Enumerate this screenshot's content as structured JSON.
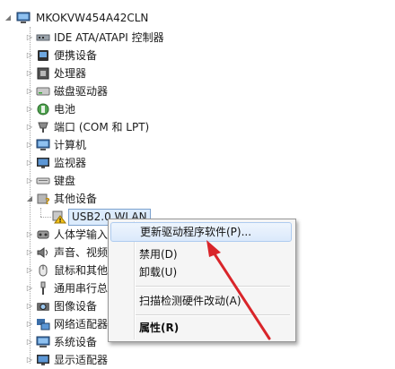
{
  "tree": {
    "root": "MKOKVW454A42CLN",
    "items": [
      {
        "label": "IDE ATA/ATAPI 控制器",
        "icon": "ide-controller-icon"
      },
      {
        "label": "便携设备",
        "icon": "portable-device-icon"
      },
      {
        "label": "处理器",
        "icon": "processor-icon"
      },
      {
        "label": "磁盘驱动器",
        "icon": "disk-drive-icon"
      },
      {
        "label": "电池",
        "icon": "battery-icon"
      },
      {
        "label": "端口 (COM 和 LPT)",
        "icon": "port-icon"
      },
      {
        "label": "计算机",
        "icon": "computer-icon"
      },
      {
        "label": "监视器",
        "icon": "monitor-icon"
      },
      {
        "label": "键盘",
        "icon": "keyboard-icon"
      },
      {
        "label": "其他设备",
        "icon": "other-devices-icon"
      },
      {
        "label": "USB2.0 WLAN",
        "icon": "warning-device-icon"
      },
      {
        "label": "人体学输入",
        "icon": "hid-icon"
      },
      {
        "label": "声音、视频",
        "icon": "sound-icon"
      },
      {
        "label": "鼠标和其他",
        "icon": "mouse-icon"
      },
      {
        "label": "通用串行总",
        "icon": "usb-icon"
      },
      {
        "label": "图像设备",
        "icon": "imaging-device-icon"
      },
      {
        "label": "网络适配器",
        "icon": "network-adapter-icon"
      },
      {
        "label": "系统设备",
        "icon": "system-device-icon"
      },
      {
        "label": "显示适配器",
        "icon": "display-adapter-icon"
      }
    ]
  },
  "context_menu": {
    "update_driver": "更新驱动程序软件(P)...",
    "disable": "禁用(D)",
    "uninstall": "卸载(U)",
    "scan_changes": "扫描检测硬件改动(A)",
    "properties": "属性(R)"
  },
  "colors": {
    "menu_highlight": "#dbe9fb",
    "selection": "#dcebfc",
    "arrow": "#d9252a"
  }
}
